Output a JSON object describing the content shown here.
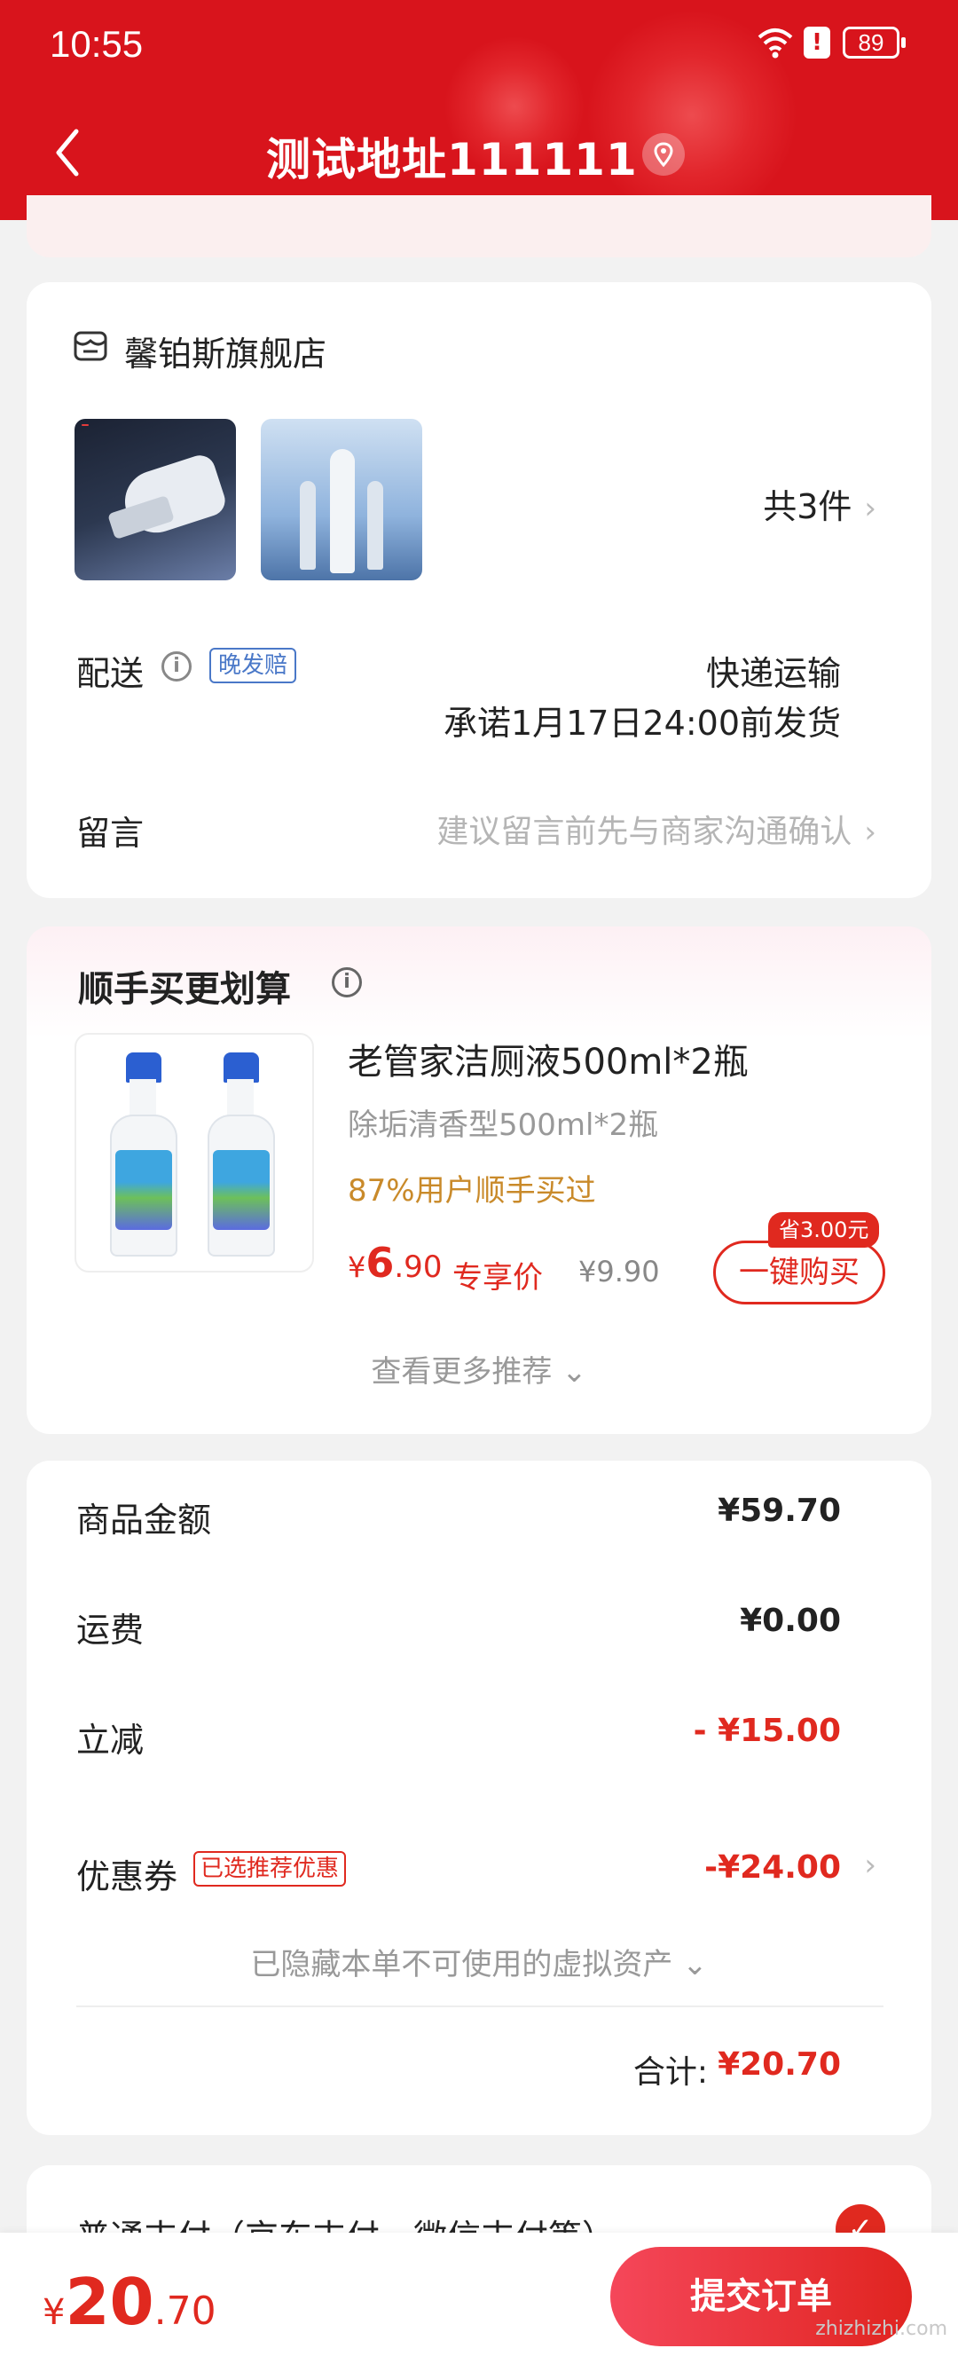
{
  "status_bar": {
    "time": "10:55",
    "battery": "89"
  },
  "header": {
    "title": "测试地址111111"
  },
  "store": {
    "name": "馨铂斯旗舰店",
    "count_label": "共3件",
    "shipping_label": "配送",
    "late_badge": "晚发赔",
    "shipping_method": "快递运输",
    "shipping_promise": "承诺1月17日24:00前发货",
    "message_label": "留言",
    "message_placeholder": "建议留言前先与商家沟通确认"
  },
  "recommend": {
    "title": "顺手买更划算",
    "product_name": "老管家洁厕液500ml*2瓶",
    "product_spec": "除垢清香型500ml*2瓶",
    "bought_note": "87%用户顺手买过",
    "price_symbol": "¥",
    "price_int": "6",
    "price_dec": ".90",
    "price_tag": "专享价",
    "original_price": "¥9.90",
    "save_tag": "省3.00元",
    "buy_button": "一键购买",
    "more_label": "查看更多推荐 ⌄"
  },
  "amounts": {
    "goods_label": "商品金额",
    "goods_value": "¥59.70",
    "freight_label": "运费",
    "freight_value": "¥0.00",
    "discount_label": "立减",
    "discount_value": "- ¥15.00",
    "coupon_label": "优惠券",
    "coupon_badge": "已选推荐优惠",
    "coupon_value": "-¥24.00",
    "hidden_assets": "已隐藏本单不可使用的虚拟资产 ⌄",
    "total_label": "合计:",
    "total_value": "¥20.70"
  },
  "payment": {
    "label": "普通支付（京东支付、微信支付等）"
  },
  "bottom": {
    "price_symbol": "¥",
    "price_int": "20",
    "price_dec": ".70",
    "submit_label": "提交订单"
  },
  "watermark": "zhizhizhi.com",
  "colors": {
    "header_red": "#d8141c",
    "price_red": "#e0291f",
    "link_blue": "#4a78c8"
  }
}
